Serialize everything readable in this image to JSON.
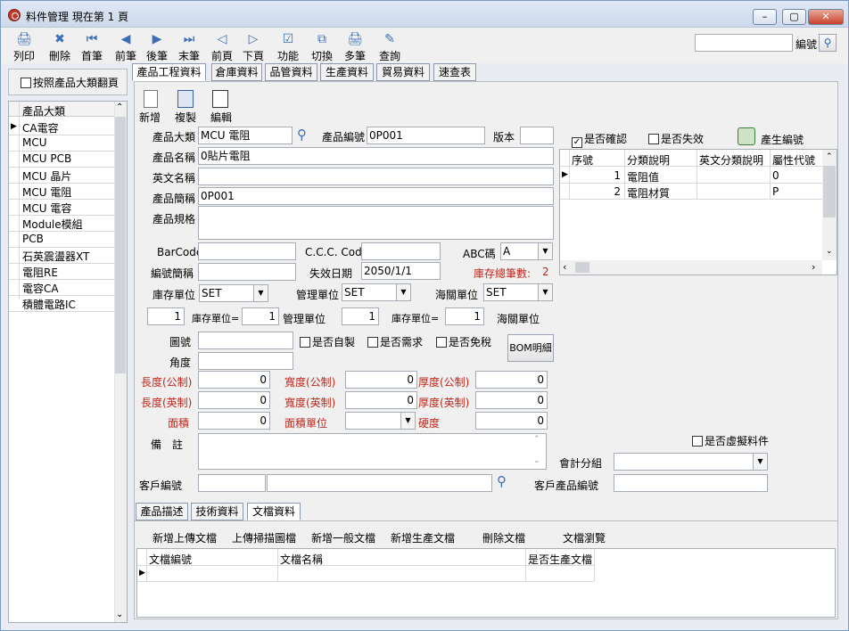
{
  "window": {
    "title": "料件管理  現在第 1 頁",
    "min_label": "–",
    "max_label": "▢",
    "close_label": "✕"
  },
  "toolbar": {
    "buttons": [
      {
        "label": "列印",
        "icon": "printer-icon",
        "glyph": "🖨"
      },
      {
        "label": "刪除",
        "icon": "delete-icon",
        "glyph": "✖"
      },
      {
        "label": "首筆",
        "icon": "first-record-icon",
        "glyph": "⏮"
      },
      {
        "label": "前筆",
        "icon": "prev-record-icon",
        "glyph": "◀"
      },
      {
        "label": "後筆",
        "icon": "next-record-icon",
        "glyph": "▶"
      },
      {
        "label": "末筆",
        "icon": "last-record-icon",
        "glyph": "⏭"
      },
      {
        "label": "前頁",
        "icon": "prev-page-icon",
        "glyph": "◁"
      },
      {
        "label": "下頁",
        "icon": "next-page-icon",
        "glyph": "▷"
      },
      {
        "label": "功能",
        "icon": "function-icon",
        "glyph": "☑"
      },
      {
        "label": "切換",
        "icon": "switch-icon",
        "glyph": "⧉"
      },
      {
        "label": "多筆",
        "icon": "multi-record-icon",
        "glyph": "🖨"
      },
      {
        "label": "查詢",
        "icon": "query-icon",
        "glyph": "✎"
      }
    ],
    "search_value": "",
    "search_label": "編號",
    "search_icon": "search-icon"
  },
  "sidebar": {
    "checkbox_label": "按照產品大類翻頁",
    "header": "產品大類",
    "items": [
      "CA電容",
      "MCU",
      "MCU PCB",
      "MCU 晶片",
      "MCU 電阻",
      "MCU 電容",
      "Module模組",
      "PCB",
      "石英震盪器XT",
      "電阻RE",
      "電容CA",
      "積體電路IC"
    ]
  },
  "tabs": [
    "產品工程資料",
    "倉庫資料",
    "品管資料",
    "生產資料",
    "貿易資料",
    "速查表"
  ],
  "subtoolbar": {
    "new": "新增",
    "copy": "複製",
    "edit": "編輯"
  },
  "form": {
    "category_label": "產品大類",
    "category_value": "MCU 電阻",
    "code_label": "產品編號",
    "code_value": "0P001",
    "version_label": "版本",
    "version_value": "",
    "name_label": "產品名稱",
    "name_value": "0貼片電阻",
    "en_name_label": "英文名稱",
    "en_name_value": "",
    "short_label": "產品簡稱",
    "short_value": "0P001",
    "spec_label": "產品規格",
    "spec_value": "",
    "barcode_label": "BarCode",
    "barcode_value": "",
    "ccc_label": "C.C.C. Code",
    "ccc_value": "",
    "abc_label": "ABC碼",
    "abc_value": "A",
    "code_short_label": "編號簡稱",
    "code_short_value": "",
    "expire_label": "失效日期",
    "expire_value": "2050/1/1",
    "stock_count_label": "庫存總筆數:",
    "stock_count_value": "2",
    "stock_unit_label": "庫存單位",
    "stock_unit_value": "SET",
    "mgmt_unit_label": "管理單位",
    "mgmt_unit_value": "SET",
    "customs_unit_label": "海關單位",
    "customs_unit_value": "SET",
    "conv1_value": "1",
    "conv_stock_label": "庫存單位=",
    "conv2_value": "1",
    "conv_mgmt_label": "管理單位",
    "conv3_value": "1",
    "conv_stock2_label": "庫存單位=",
    "conv4_value": "1",
    "conv_customs_label": "海關單位",
    "drawing_label": "圖號",
    "drawing_value": "",
    "self_made_label": "是否自製",
    "demand_label": "是否需求",
    "tax_free_label": "是否免稅",
    "bom_label": "BOM明細",
    "angle_label": "角度",
    "angle_value": "",
    "len_m_label": "長度(公制)",
    "len_m_value": "0",
    "wid_m_label": "寬度(公制)",
    "wid_m_value": "0",
    "thk_m_label": "厚度(公制)",
    "thk_m_value": "0",
    "len_i_label": "長度(英制)",
    "len_i_value": "0",
    "wid_i_label": "寬度(英制)",
    "wid_i_value": "0",
    "thk_i_label": "厚度(英制)",
    "thk_i_value": "0",
    "area_label": "面積",
    "area_value": "0",
    "area_unit_label": "面積單位",
    "area_unit_value": "",
    "hardness_label": "硬度",
    "hardness_value": "0",
    "note_label": "備　註",
    "note_value": "",
    "virtual_label": "是否虛擬料件",
    "acct_label": "會計分組",
    "acct_value": "",
    "cust_code_label": "客戶編號",
    "cust_code_value": "",
    "cust_name_value": "",
    "cust_prod_label": "客戶產品編號",
    "cust_prod_value": ""
  },
  "right": {
    "confirmed_label": "是否確認",
    "confirmed": true,
    "invalid_label": "是否失效",
    "invalid": false,
    "gen_code_label": "產生編號",
    "grid": {
      "headers": [
        "序號",
        "分類說明",
        "英文分類說明",
        "屬性代號"
      ],
      "rows": [
        [
          "1",
          "電阻值",
          "",
          "0"
        ],
        [
          "2",
          "電阻材質",
          "",
          "P"
        ]
      ]
    }
  },
  "bottom_tabs": [
    "產品描述",
    "技術資料",
    "文檔資料"
  ],
  "doc_actions": [
    "新增上傳文檔",
    "上傳掃描圖檔",
    "新增一般文檔",
    "新增生產文檔",
    "刪除文檔",
    "文檔瀏覽"
  ],
  "doc_grid": {
    "headers": [
      "文檔編號",
      "文檔名稱",
      "是否生產文檔"
    ]
  }
}
